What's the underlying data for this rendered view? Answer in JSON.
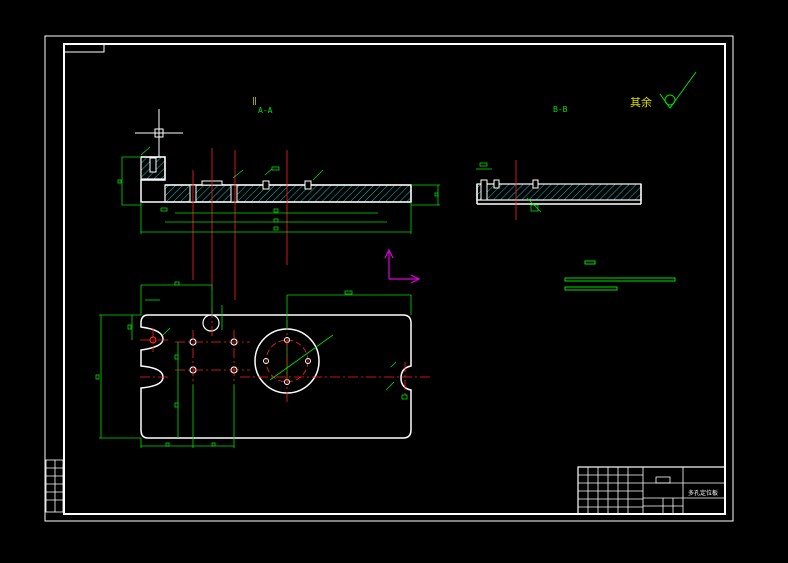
{
  "drawing": {
    "background": "#000000",
    "colors": {
      "border": "#ffffff",
      "dimension": "#00e000",
      "centerline": "#ff2020",
      "hatch": "#00c8c8",
      "outline": "#ffffff",
      "ucs": "#e000e0",
      "label": "#e0e000"
    },
    "view_labels": {
      "section_a": "A-A",
      "section_b": "B-B"
    },
    "surface_finish_note": "其余",
    "title_block": {
      "drawing_name": "多孔定位板"
    },
    "icons": {
      "crosshair": "crosshair-icon",
      "ucs": "ucs-axis-icon",
      "roughness": "roughness-symbol-icon"
    }
  }
}
